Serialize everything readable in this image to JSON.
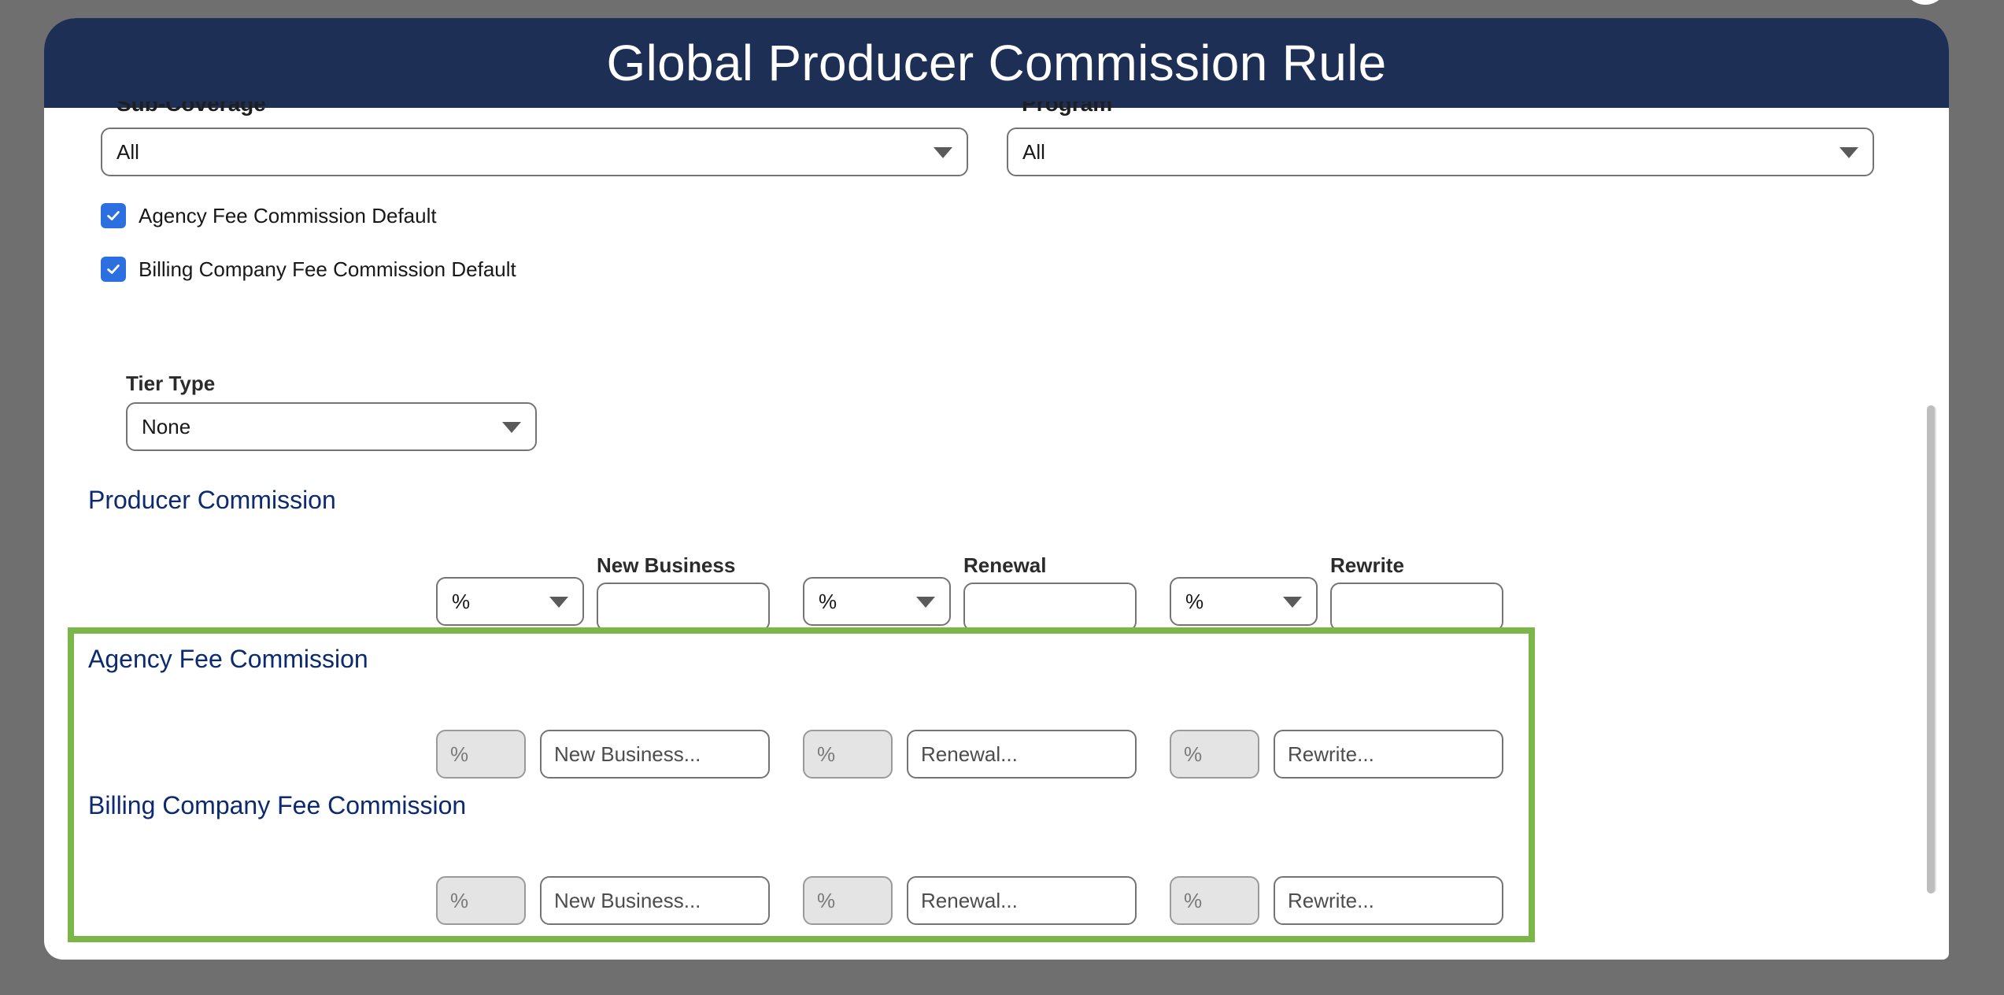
{
  "modal": {
    "title": "Global Producer Commission Rule"
  },
  "filters": {
    "sub_coverage": {
      "label": "Sub-Coverage",
      "value": "All"
    },
    "program": {
      "label": "Program",
      "value": "All"
    }
  },
  "defaults": {
    "agency_fee_default": {
      "label": "Agency Fee Commission Default",
      "checked": true
    },
    "billing_fee_default": {
      "label": "Billing Company Fee Commission Default",
      "checked": true
    }
  },
  "tier_type": {
    "label": "Tier Type",
    "value": "None"
  },
  "producer_commission": {
    "title": "Producer Commission",
    "columns": [
      {
        "label": "New Business",
        "unit": "%",
        "value": ""
      },
      {
        "label": "Renewal",
        "unit": "%",
        "value": ""
      },
      {
        "label": "Rewrite",
        "unit": "%",
        "value": ""
      }
    ]
  },
  "agency_fee_commission": {
    "title": "Agency Fee Commission",
    "fields": [
      {
        "unit": "%",
        "placeholder": "New Business..."
      },
      {
        "unit": "%",
        "placeholder": "Renewal..."
      },
      {
        "unit": "%",
        "placeholder": "Rewrite..."
      }
    ]
  },
  "billing_fee_commission": {
    "title": "Billing Company Fee Commission",
    "fields": [
      {
        "unit": "%",
        "placeholder": "New Business..."
      },
      {
        "unit": "%",
        "placeholder": "Renewal..."
      },
      {
        "unit": "%",
        "placeholder": "Rewrite..."
      }
    ]
  },
  "colors": {
    "header_bg": "#1e2f56",
    "accent_checkbox": "#2b6fe0",
    "section_title": "#0b2a6f",
    "highlight_border": "#7ab648"
  },
  "icons": {
    "dropdown": "chevron-down-icon",
    "checkbox": "checkmark-icon"
  }
}
